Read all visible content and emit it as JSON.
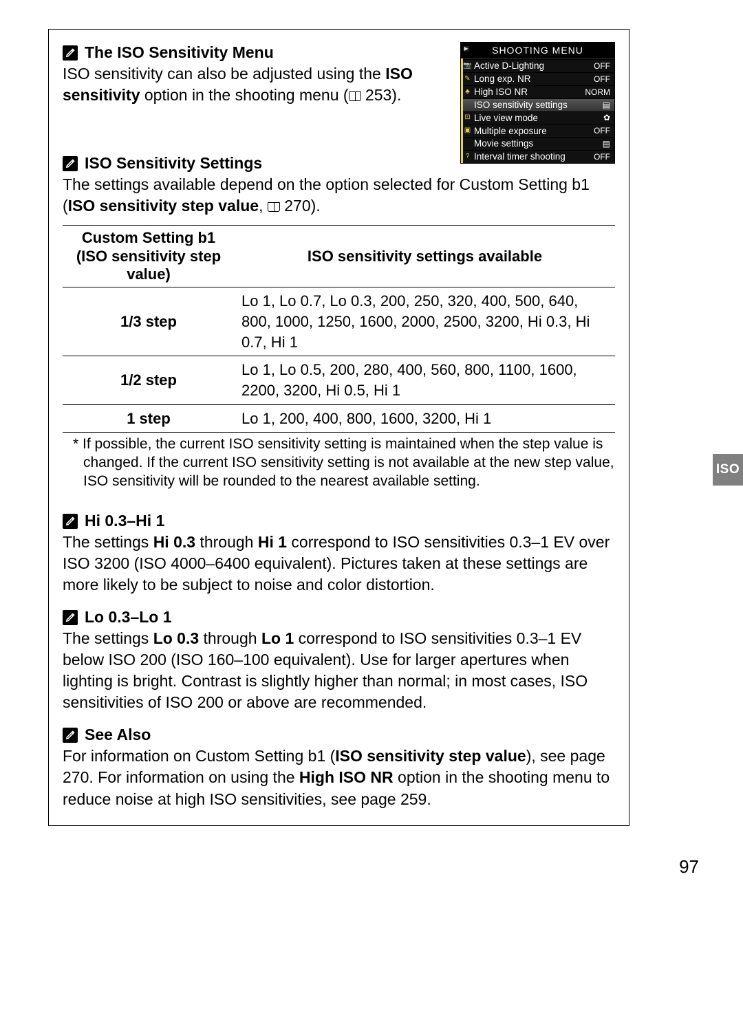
{
  "sections": {
    "iso_menu": {
      "title": "The ISO Sensitivity Menu",
      "line1_a": "ISO sensitivity can also be adjusted using the ",
      "line1_bold": "ISO sensitivity",
      "line1_b": " option in the shooting menu (",
      "line1_pageref": " 253)."
    },
    "iso_settings": {
      "title": "ISO Sensitivity Settings",
      "body_a": "The settings available depend on the option selected for Custom Setting b1 (",
      "body_bold": "ISO sensitivity step value",
      "body_b": ", ",
      "body_pageref": " 270)."
    },
    "hi": {
      "title": "Hi 0.3–Hi 1",
      "body_a": "The settings ",
      "body_bold1": "Hi 0.3",
      "body_mid": " through ",
      "body_bold2": "Hi 1",
      "body_b": " correspond to ISO sensitivities 0.3–1 EV over ISO 3200 (ISO 4000–6400 equivalent).  Pictures taken at these settings are more likely to be subject to noise and color distortion."
    },
    "lo": {
      "title": "Lo 0.3–Lo 1",
      "body_a": "The settings ",
      "body_bold1": "Lo 0.3",
      "body_mid": " through ",
      "body_bold2": "Lo 1",
      "body_b": " correspond to ISO sensitivities 0.3–1 EV  below ISO 200 (ISO 160–100 equivalent).  Use for larger apertures when lighting is bright.  Contrast is slightly higher than normal; in most cases, ISO sensitivities of ISO 200 or above are recommended."
    },
    "see_also": {
      "title": "See Also",
      "body_a": "For information on Custom Setting b1 (",
      "body_bold1": "ISO sensitivity step value",
      "body_mid": "), see page 270.  For information on using the ",
      "body_bold2": "High ISO NR",
      "body_b": " option in the shooting menu to reduce noise at high ISO sensitivities, see page 259."
    }
  },
  "table": {
    "header_left_line1": "Custom Setting b1",
    "header_left_line2": "(ISO sensitivity step value)",
    "header_right": "ISO sensitivity settings available",
    "rows": [
      {
        "label": "1/3 step",
        "values": "Lo 1, Lo 0.7, Lo 0.3, 200, 250, 320, 400, 500, 640, 800, 1000, 1250, 1600, 2000, 2500, 3200, Hi 0.3, Hi 0.7, Hi 1"
      },
      {
        "label": "1/2 step",
        "values": "Lo 1, Lo 0.5, 200, 280, 400, 560, 800, 1100, 1600, 2200, 3200, Hi 0.5, Hi 1"
      },
      {
        "label": "1 step",
        "values": "Lo 1, 200, 400, 800, 1600, 3200, Hi 1"
      }
    ],
    "footnote": "If possible, the current ISO sensitivity setting is maintained when the step value is changed.  If the current ISO sensitivity setting is not available at the new step value, ISO sensitivity will be rounded to the nearest available setting."
  },
  "lcd": {
    "title": "SHOOTING MENU",
    "rows": [
      {
        "icon": "📷",
        "label": "Active D-Lighting",
        "value": "OFF",
        "selected": false
      },
      {
        "icon": "✎",
        "label": "Long exp. NR",
        "value": "OFF",
        "selected": false
      },
      {
        "icon": "♣",
        "label": "High ISO NR",
        "value": "NORM",
        "selected": false
      },
      {
        "icon": "",
        "label": "ISO sensitivity settings",
        "value": "▤",
        "selected": true
      },
      {
        "icon": "⊡",
        "label": "Live view mode",
        "value": "✿",
        "selected": false
      },
      {
        "icon": "▣",
        "label": "Multiple exposure",
        "value": "OFF",
        "selected": false
      },
      {
        "icon": "",
        "label": "Movie settings",
        "value": "▤",
        "selected": false
      },
      {
        "icon": "?",
        "label": "Interval timer shooting",
        "value": "OFF",
        "selected": false
      }
    ]
  },
  "side_tab": "ISO",
  "page_number": "97",
  "footnote_marker": "*"
}
